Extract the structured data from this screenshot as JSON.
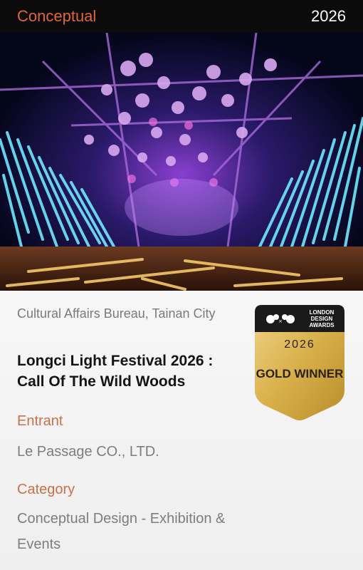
{
  "header": {
    "category_tag": "Conceptual",
    "year": "2026"
  },
  "entry": {
    "client": "Cultural Affairs Bureau, Tainan City",
    "title": "Longci Light Festival 2026 : Call Of The Wild Woods"
  },
  "entrant": {
    "label": "Entrant",
    "value": "Le Passage CO., LTD."
  },
  "category": {
    "label": "Category",
    "value": "Conceptual Design - Exhibition & Events"
  },
  "badge": {
    "organization": "LONDON DESIGN AWARDS",
    "year": "2026",
    "award": "GOLD WINNER"
  },
  "colors": {
    "accent": "#e0653a",
    "label": "#c8714a",
    "header_bg": "#0b0b0c",
    "gold": "#d8b04a"
  }
}
